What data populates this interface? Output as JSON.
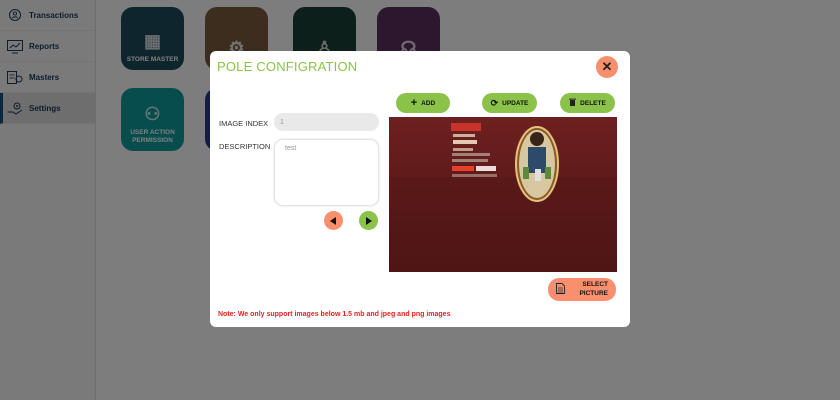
{
  "sidebar": {
    "items": [
      {
        "label": "Transactions",
        "icon": "transactions-icon"
      },
      {
        "label": "Reports",
        "icon": "reports-icon"
      },
      {
        "label": "Masters",
        "icon": "masters-icon"
      },
      {
        "label": "Settings",
        "icon": "settings-icon",
        "active": true
      }
    ]
  },
  "tiles": [
    {
      "label": "STORE MASTER",
      "color": "#1f4a5c"
    },
    {
      "label": "",
      "color": "#7b5a3e"
    },
    {
      "label": "",
      "color": "#183f35"
    },
    {
      "label": "",
      "color": "#5a2f5e"
    },
    {
      "label": "USER ACTION PERMISSION",
      "color": "#109a9a"
    },
    {
      "label": "",
      "color": "#2b3a8a"
    }
  ],
  "modal": {
    "title": "POLE CONFIGRATION",
    "close_symbol": "✕",
    "image_index_label": "IMAGE INDEX",
    "image_index_value": "1",
    "description_label": "DESCRIPTION",
    "description_value": "test",
    "add_label": "ADD",
    "update_label": "UPDATE",
    "delete_label": "DELETE",
    "select_picture_label_1": "SELECT",
    "select_picture_label_2": "PICTURE",
    "note": "Note: We only support images below 1.5 mb and jpeg and png images"
  },
  "colors": {
    "accent_green": "#8bc34a",
    "accent_orange": "#fa8f6e",
    "note_red": "#e82020",
    "image_bg": "#5a1a1a"
  }
}
